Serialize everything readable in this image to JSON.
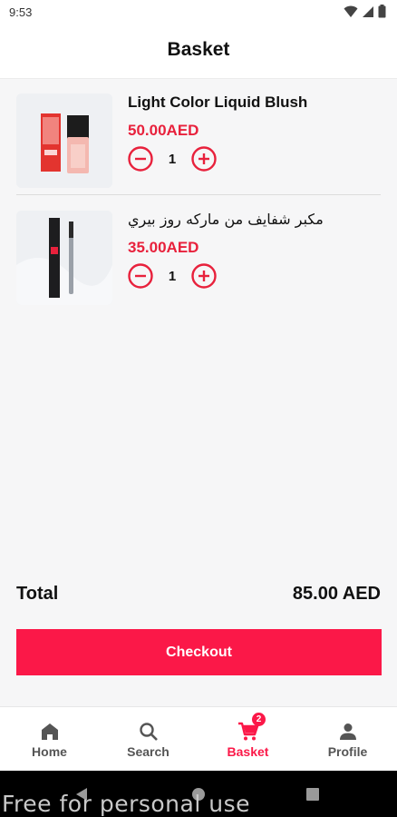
{
  "status_bar": {
    "time": "9:53"
  },
  "header": {
    "title": "Basket"
  },
  "cart": {
    "items": [
      {
        "name": "Light Color Liquid Blush",
        "price": "50.00AED",
        "quantity": "1",
        "image": "blush-bottle-image"
      },
      {
        "name": "مكبر شفايف من ماركه روز بيري",
        "price": "35.00AED",
        "quantity": "1",
        "image": "lip-plumper-image"
      }
    ],
    "total_label": "Total",
    "total_value": "85.00 AED",
    "checkout_label": "Checkout"
  },
  "bottom_nav": {
    "items": [
      {
        "label": "Home",
        "icon": "home-icon",
        "active": false
      },
      {
        "label": "Search",
        "icon": "search-icon",
        "active": false
      },
      {
        "label": "Basket",
        "icon": "cart-icon",
        "active": true,
        "badge": "2"
      },
      {
        "label": "Profile",
        "icon": "profile-icon",
        "active": false
      }
    ]
  },
  "watermark": "Free for personal use",
  "colors": {
    "accent": "#fb1848",
    "price": "#e8213c",
    "background": "#f6f6f7"
  }
}
